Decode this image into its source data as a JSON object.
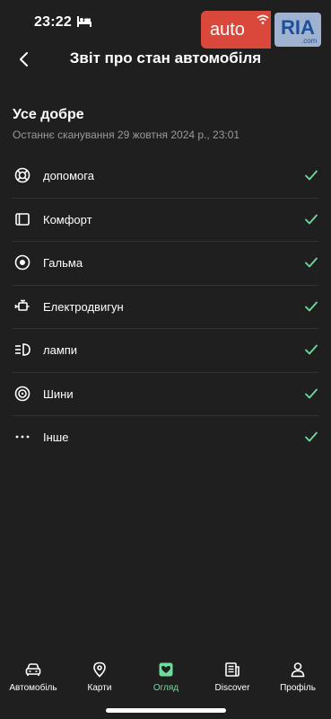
{
  "status_bar": {
    "time": "23:22"
  },
  "watermark": {
    "auto": "auto",
    "ria": "RIA",
    "domain": ".com"
  },
  "header": {
    "title": "Звіт про стан автомобіля"
  },
  "summary": {
    "title": "Усе добре",
    "subtitle": "Останнє сканування 29 жовтня 2024 р., 23:01"
  },
  "items": [
    {
      "label": "допомога",
      "icon": "lifebuoy-icon",
      "status": "ok"
    },
    {
      "label": "Комфорт",
      "icon": "seat-icon",
      "status": "ok"
    },
    {
      "label": "Гальма",
      "icon": "brake-icon",
      "status": "ok"
    },
    {
      "label": "Електродвигун",
      "icon": "engine-icon",
      "status": "ok"
    },
    {
      "label": "лампи",
      "icon": "headlight-icon",
      "status": "ok"
    },
    {
      "label": "Шини",
      "icon": "tire-icon",
      "status": "ok"
    },
    {
      "label": "Інше",
      "icon": "more-icon",
      "status": "ok"
    }
  ],
  "nav": [
    {
      "label": "Автомобіль",
      "icon": "car-icon",
      "active": false
    },
    {
      "label": "Карти",
      "icon": "map-pin-icon",
      "active": false
    },
    {
      "label": "Огляд",
      "icon": "heart-icon",
      "active": true
    },
    {
      "label": "Discover",
      "icon": "news-icon",
      "active": false
    },
    {
      "label": "Профіль",
      "icon": "person-icon",
      "active": false
    }
  ],
  "colors": {
    "background": "#1f1f1f",
    "accent": "#6fdc9b",
    "divider": "#333333",
    "muted": "#9a9a9a"
  }
}
